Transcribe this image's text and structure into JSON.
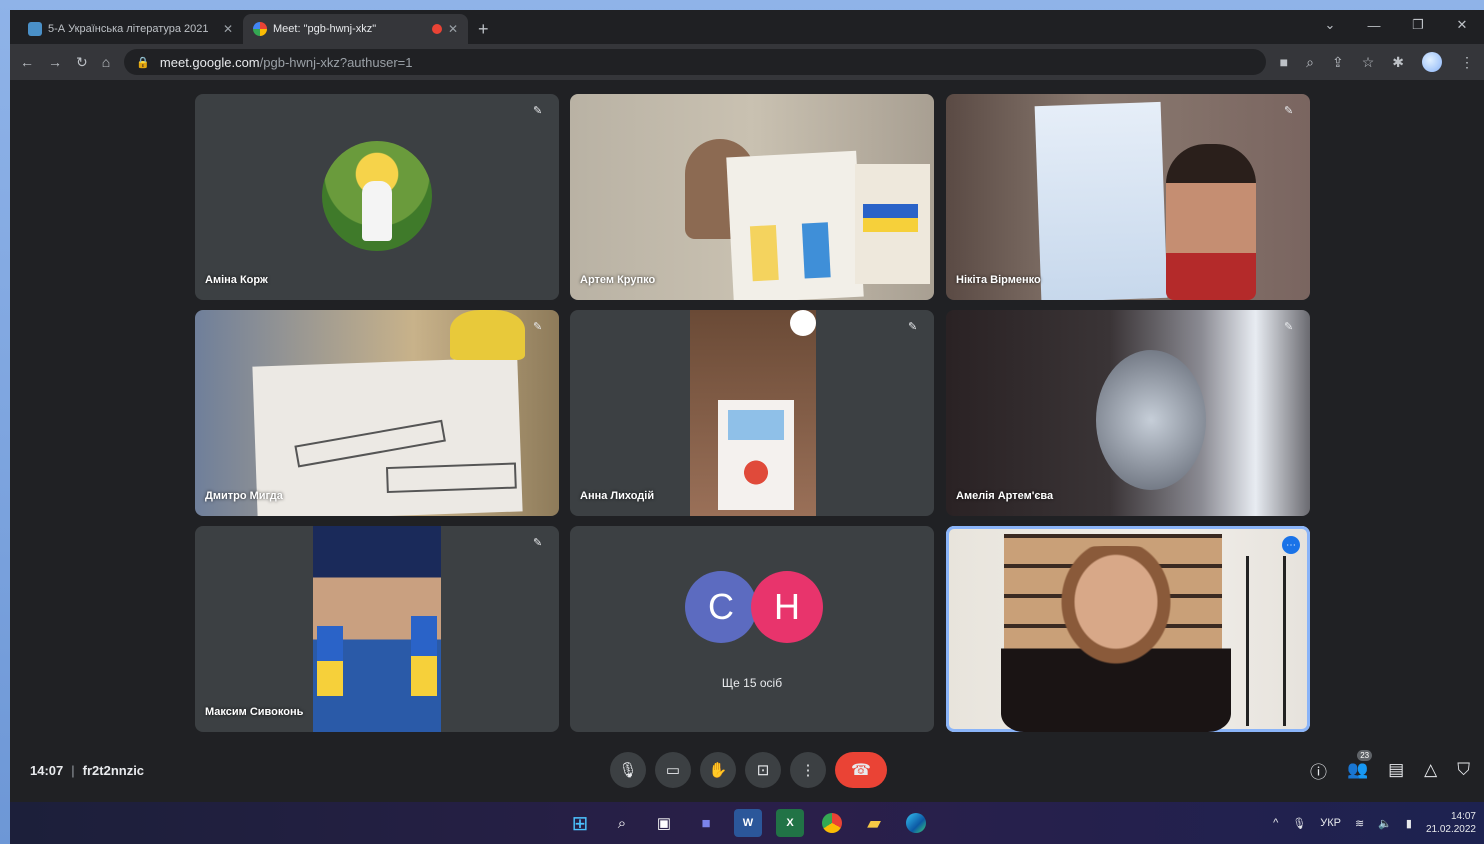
{
  "browser": {
    "tabs": [
      {
        "title": "5-А Українська література 2021",
        "favicon_color": "#4a90c8",
        "active": false
      },
      {
        "title": "Meet: \"pgb-hwnj-xkz\"",
        "favicon_color": "#00ac47",
        "active": true
      }
    ],
    "new_tab": "+",
    "url_host": "meet.google.com",
    "url_path": "/pgb-hwnj-xkz?authuser=1"
  },
  "tiles": [
    {
      "name": "Аміна Корж",
      "muted": true
    },
    {
      "name": "Артем Крупко",
      "muted": false
    },
    {
      "name": "Нікіта Вірменко",
      "muted": true
    },
    {
      "name": "Дмитро Мигда",
      "muted": true
    },
    {
      "name": "Анна Лиходій",
      "muted": true
    },
    {
      "name": "Амелія Артем'єва",
      "muted": true
    },
    {
      "name": "Максим Сивоконь",
      "muted": true
    },
    {
      "name": "",
      "muted": false
    },
    {
      "name": "",
      "muted": false
    }
  ],
  "others": {
    "initials": [
      "C",
      "H"
    ],
    "text": "Ще 15 осіб",
    "colors": [
      "#5c6bc0",
      "#e8346c"
    ]
  },
  "meeting": {
    "time": "14:07",
    "code": "fr2t2nnzic",
    "participants_count": "23"
  },
  "taskbar": {
    "lang": "УКР",
    "time": "14:07",
    "date": "21.02.2022"
  },
  "accent": "#8ab4f8",
  "end_call_color": "#ea4335"
}
